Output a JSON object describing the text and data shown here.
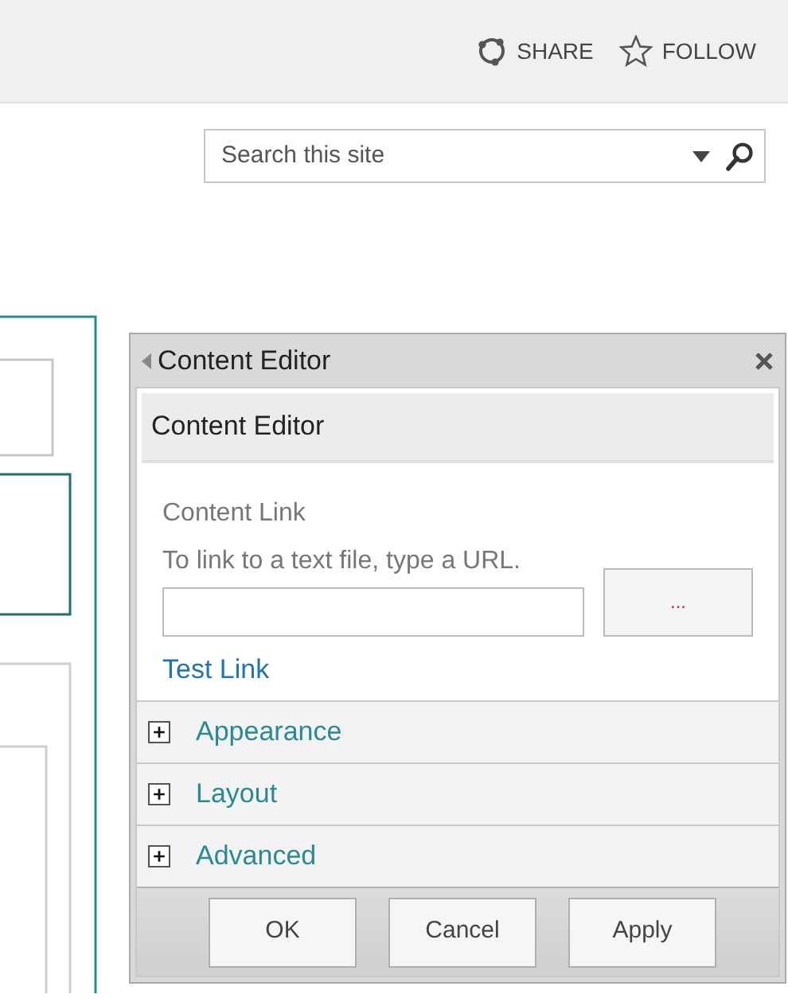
{
  "top_bar": {
    "actions": [
      {
        "kind": "share",
        "label": "SHARE"
      },
      {
        "kind": "follow",
        "label": "FOLLOW"
      }
    ]
  },
  "search": {
    "placeholder": "Search this site"
  },
  "tool_pane": {
    "title": "Content Editor",
    "section_title": "Content Editor",
    "field_label": "Content Link",
    "hint": "To link to a text file, type a URL.",
    "browse_button": "...",
    "test_link": "Test Link",
    "groups": [
      {
        "label": "Appearance",
        "expanded": false
      },
      {
        "label": "Layout",
        "expanded": false
      },
      {
        "label": "Advanced",
        "expanded": false
      }
    ],
    "buttons": [
      "OK",
      "Cancel",
      "Apply"
    ]
  }
}
